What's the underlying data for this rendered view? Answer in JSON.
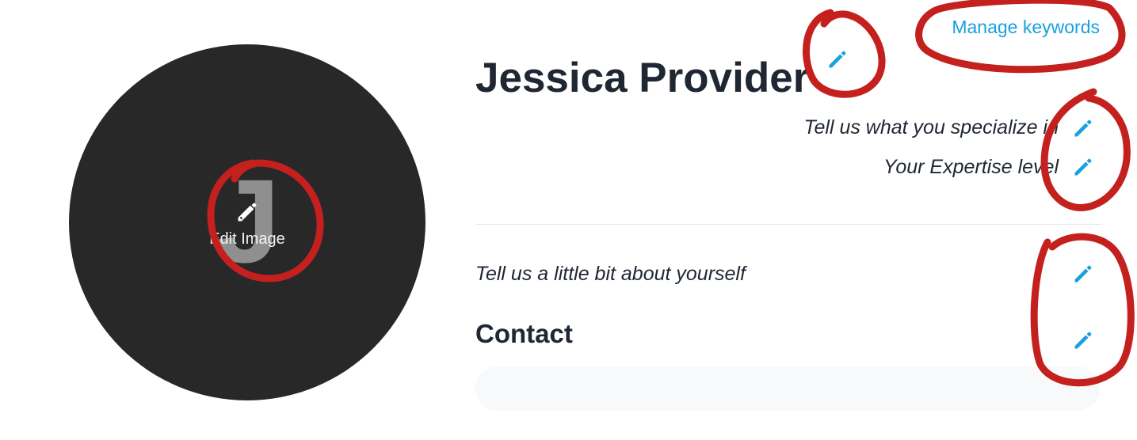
{
  "profile": {
    "avatar_initial": "J",
    "edit_image_label": "Edit Image",
    "name": "Jessica Provider",
    "specialize_placeholder": "Tell us what you specialize in",
    "expertise_placeholder": "Your Expertise level",
    "about_placeholder": "Tell us a little bit about yourself",
    "contact_heading": "Contact"
  },
  "header": {
    "manage_keywords_label": "Manage keywords"
  },
  "icons": {
    "edit": "pencil-icon"
  },
  "colors": {
    "accent": "#1aa0de",
    "avatar_bg": "#282828",
    "annotation": "#c4201e",
    "text": "#1f2733"
  }
}
